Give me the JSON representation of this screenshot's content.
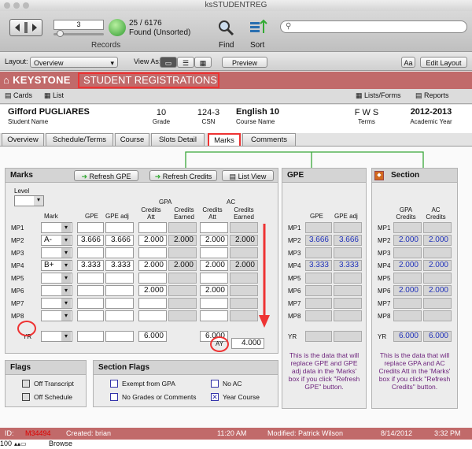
{
  "window": {
    "title": "ksSTUDENTREG"
  },
  "toolbar": {
    "record_number": "3",
    "records_label": "Records",
    "found_count": "25 / 6176",
    "found_status": "Found (Unsorted)",
    "find_label": "Find",
    "sort_label": "Sort"
  },
  "layoutbar": {
    "layout_label": "Layout:",
    "layout_value": "Overview",
    "viewas_label": "View As:",
    "preview_label": "Preview",
    "aa_label": "Aa",
    "edit_layout_label": "Edit Layout"
  },
  "app": {
    "logo": "KEYSTONE",
    "title": "STUDENT REGISTRATIONS"
  },
  "subbar": {
    "cards": "Cards",
    "list": "List",
    "lists_forms": "Lists/Forms",
    "reports": "Reports"
  },
  "student": {
    "name": "Gifford PUGLIARES",
    "name_label": "Student Name",
    "grade": "10",
    "grade_label": "Grade",
    "csn": "124-3",
    "csn_label": "CSN",
    "course": "English 10",
    "course_label": "Course Name",
    "terms": "F W S",
    "terms_label": "Terms",
    "year": "2012-2013",
    "year_label": "Academic Year"
  },
  "tabs": [
    "Overview",
    "Schedule/Terms",
    "Course",
    "Slots Detail",
    "Marks",
    "Comments"
  ],
  "marks": {
    "title": "Marks",
    "refresh_gpe": "Refresh GPE",
    "refresh_credits": "Refresh Credits",
    "list_view": "List View",
    "level_label": "Level",
    "col_mark": "Mark",
    "col_gpe": "GPE",
    "col_gpe_adj": "GPE adj",
    "gpa_header": "GPA",
    "ac_header": "AC",
    "col_credits_att": "Credits Att",
    "col_credits_earned": "Credits Earned",
    "rows": [
      {
        "label": "MP1",
        "mark": "",
        "gpe": "",
        "gpe_adj": "",
        "gpa_att": "",
        "gpa_earned": "",
        "ac_att": "",
        "ac_earned": ""
      },
      {
        "label": "MP2",
        "mark": "A-",
        "gpe": "3.666",
        "gpe_adj": "3.666",
        "gpa_att": "2.000",
        "gpa_earned": "2.000",
        "ac_att": "2.000",
        "ac_earned": "2.000"
      },
      {
        "label": "MP3",
        "mark": "",
        "gpe": "",
        "gpe_adj": "",
        "gpa_att": "",
        "gpa_earned": "",
        "ac_att": "",
        "ac_earned": ""
      },
      {
        "label": "MP4",
        "mark": "B+",
        "gpe": "3.333",
        "gpe_adj": "3.333",
        "gpa_att": "2.000",
        "gpa_earned": "2.000",
        "ac_att": "2.000",
        "ac_earned": "2.000"
      },
      {
        "label": "MP5",
        "mark": "",
        "gpe": "",
        "gpe_adj": "",
        "gpa_att": "",
        "gpa_earned": "",
        "ac_att": "",
        "ac_earned": ""
      },
      {
        "label": "MP6",
        "mark": "",
        "gpe": "",
        "gpe_adj": "",
        "gpa_att": "2.000",
        "gpa_earned": "",
        "ac_att": "2.000",
        "ac_earned": ""
      },
      {
        "label": "MP7",
        "mark": "",
        "gpe": "",
        "gpe_adj": "",
        "gpa_att": "",
        "gpa_earned": "",
        "ac_att": "",
        "ac_earned": ""
      },
      {
        "label": "MP8",
        "mark": "",
        "gpe": "",
        "gpe_adj": "",
        "gpa_att": "",
        "gpa_earned": "",
        "ac_att": "",
        "ac_earned": ""
      },
      {
        "label": "YR",
        "mark": "",
        "gpe": "",
        "gpe_adj": "",
        "gpa_att": "6.000",
        "gpa_earned": "",
        "ac_att": "6.000",
        "ac_earned": ""
      }
    ],
    "ay_label": "AY",
    "ay_value": "4.000"
  },
  "gpe": {
    "title": "GPE",
    "col_gpe": "GPE",
    "col_gpe_adj": "GPE adj",
    "rows": [
      {
        "label": "MP1",
        "gpe": "",
        "gpe_adj": ""
      },
      {
        "label": "MP2",
        "gpe": "3.666",
        "gpe_adj": "3.666"
      },
      {
        "label": "MP3",
        "gpe": "",
        "gpe_adj": ""
      },
      {
        "label": "MP4",
        "gpe": "3.333",
        "gpe_adj": "3.333"
      },
      {
        "label": "MP5",
        "gpe": "",
        "gpe_adj": ""
      },
      {
        "label": "MP6",
        "gpe": "",
        "gpe_adj": ""
      },
      {
        "label": "MP7",
        "gpe": "",
        "gpe_adj": ""
      },
      {
        "label": "MP8",
        "gpe": "",
        "gpe_adj": ""
      },
      {
        "label": "YR",
        "gpe": "",
        "gpe_adj": ""
      }
    ],
    "note": "This is the data that will replace GPE and GPE adj data in the 'Marks' box if you click \"Refresh GPE\" button."
  },
  "section": {
    "title": "Section",
    "col_gpa": "GPA Credits",
    "col_ac": "AC Credits",
    "rows": [
      {
        "label": "MP1",
        "gpa": "",
        "ac": ""
      },
      {
        "label": "MP2",
        "gpa": "2.000",
        "ac": "2.000"
      },
      {
        "label": "MP3",
        "gpa": "",
        "ac": ""
      },
      {
        "label": "MP4",
        "gpa": "2.000",
        "ac": "2.000"
      },
      {
        "label": "MP5",
        "gpa": "",
        "ac": ""
      },
      {
        "label": "MP6",
        "gpa": "2.000",
        "ac": "2.000"
      },
      {
        "label": "MP7",
        "gpa": "",
        "ac": ""
      },
      {
        "label": "MP8",
        "gpa": "",
        "ac": ""
      },
      {
        "label": "YR",
        "gpa": "6.000",
        "ac": "6.000"
      }
    ],
    "note": "This is the data that will replace GPA and AC Credits Att in the 'Marks' box if you click \"Refresh Credits\" button."
  },
  "flags": {
    "title": "Flags",
    "off_transcript": "Off Transcript",
    "off_schedule": "Off Schedule"
  },
  "section_flags": {
    "title": "Section Flags",
    "exempt_gpa": "Exempt from GPA",
    "no_grades": "No Grades or Comments",
    "no_ac": "No AC",
    "year_course": "Year Course"
  },
  "footer": {
    "id_label": "ID:",
    "id_value": "M34494",
    "created_label": "Created: brian",
    "created_time": "11:20 AM",
    "modified_label": "Modified: Patrick Wilson",
    "modified_date": "8/14/2012",
    "modified_time": "3:32 PM"
  },
  "statusbar": {
    "zoom": "100",
    "mode": "Browse"
  },
  "colors": {
    "brand_red": "#c16a6a",
    "highlight_red": "#e33",
    "value_blue": "#2233bb",
    "note_purple": "#6a1f7a",
    "arrow_green": "#39a839"
  }
}
